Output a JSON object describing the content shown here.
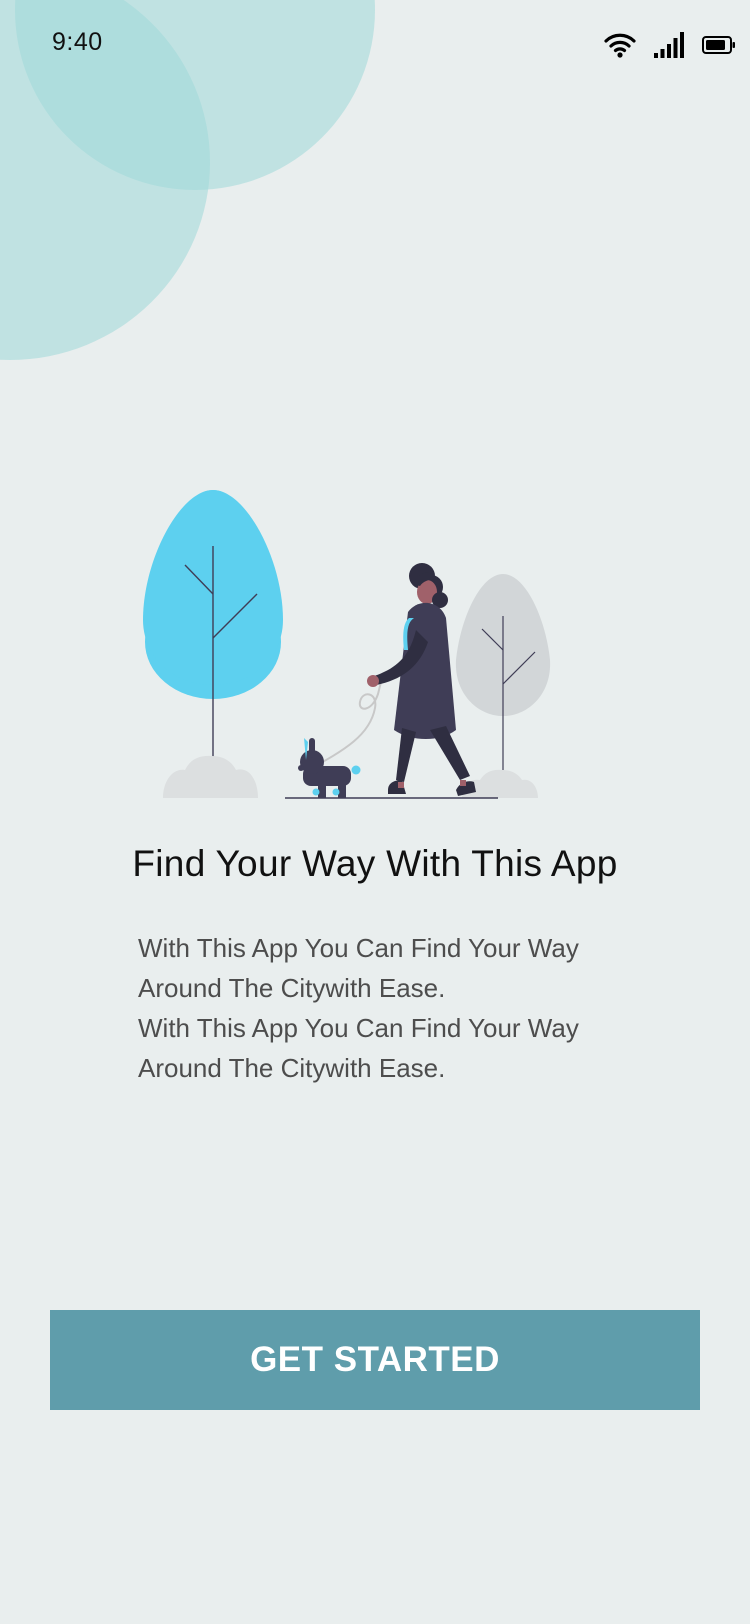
{
  "status_bar": {
    "time": "9:40",
    "icons": [
      "wifi-icon",
      "cellular-signal-icon",
      "battery-icon"
    ]
  },
  "illustration": {
    "name": "person-walking-dog-illustration"
  },
  "onboarding": {
    "title": "Find Your Way With This App",
    "description_lines": [
      "With This App You Can Find Your Way Around The Citywith Ease.",
      "With This App You Can Find Your Way Around The Citywith Ease."
    ],
    "cta_label": "GET STARTED"
  },
  "colors": {
    "background": "#e9eeee",
    "decorative_blob": "#9fd8d8",
    "tree_accent": "#5dd0ef",
    "button": "#5f9dab",
    "button_text": "#ffffff",
    "title_text": "#111111",
    "body_text": "#4d4d4d"
  }
}
